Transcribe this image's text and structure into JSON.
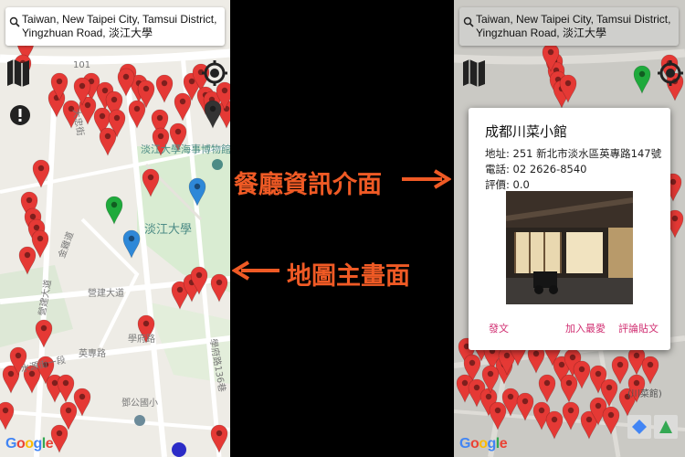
{
  "search": {
    "line1": "Taiwan, New Taipei City, Tamsui District,",
    "line2": "Yingzhuan Road, 淡江大學"
  },
  "left_map": {
    "labels": {
      "road101": "101",
      "dazhong": "大忠街",
      "museum": "淡江大學海事博物館",
      "campus": "淡江大學",
      "jinsan": "金雞道",
      "yingzhuan": "營建大道",
      "xuefu": "學府路",
      "yingzhuan2": "英專路",
      "shuiyuan": "水源街一段",
      "dengsuo": "鄧公國小",
      "xuefu2": "學府路136巷"
    }
  },
  "right_map": {
    "labels": {
      "restaurant": "(川菜館)"
    }
  },
  "annotations": {
    "info_interface": "餐廳資訊介面",
    "main_map": "地圖主畫面"
  },
  "dialog": {
    "name": "成都川菜小館",
    "address": "地址: 251 新北市淡水區英專路147號",
    "phone": "電話: 02 2626-8540",
    "rating": "評價: 0.0",
    "post_button": "發文",
    "favorite_button": "加入最愛",
    "review_button": "評論貼文"
  },
  "google_logo": [
    "G",
    "o",
    "o",
    "g",
    "l",
    "e"
  ],
  "colors": {
    "marker_red": "#e53935",
    "marker_green": "#1faa3c",
    "marker_blue": "#2e88d8",
    "annotation_orange": "#ef5a25",
    "dialog_button_pink": "#d12f72"
  },
  "icons": {
    "map": "map-icon",
    "location": "my-location-icon",
    "alert": "alert-icon",
    "search": "search-icon"
  }
}
